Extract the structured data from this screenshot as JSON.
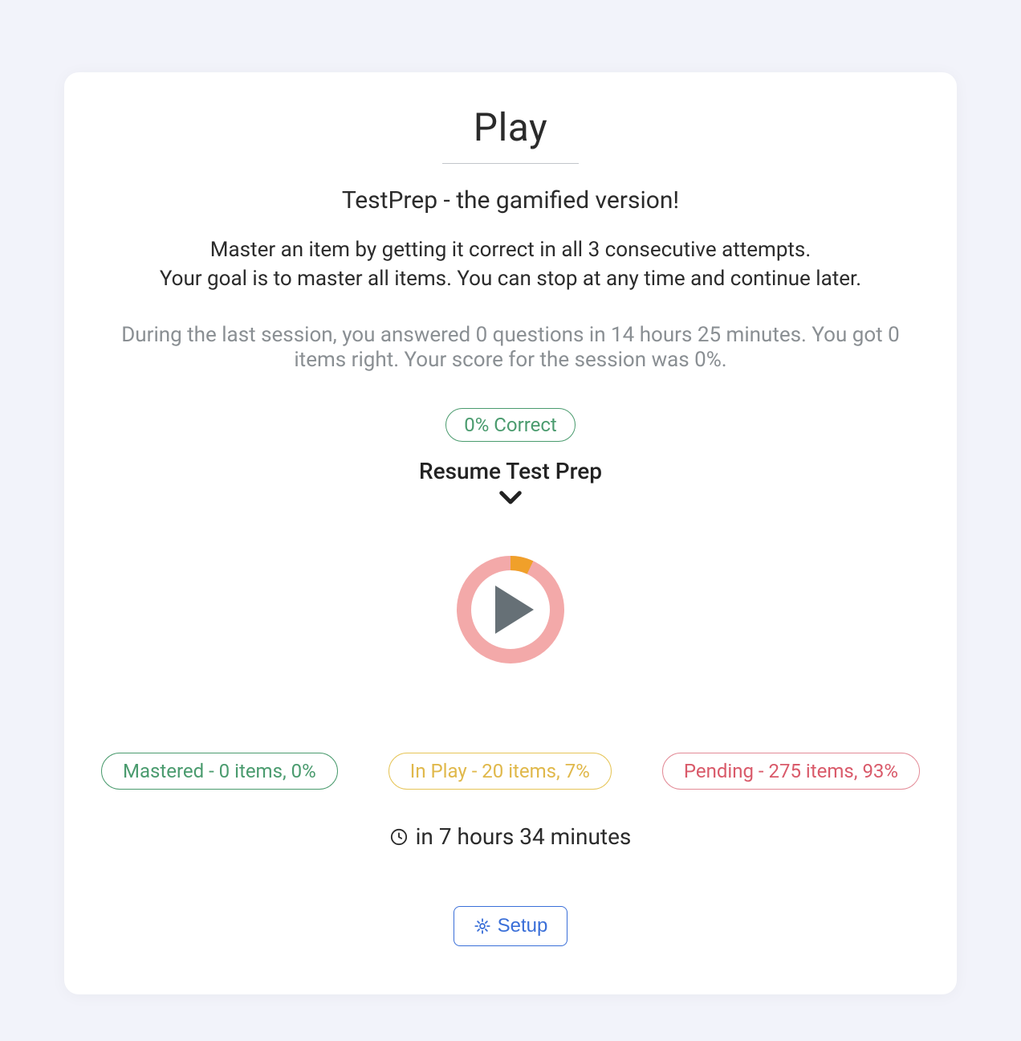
{
  "header": {
    "title": "Play",
    "subtitle": "TestPrep - the gamified version!",
    "intro_line1": "Master an item by getting it correct in all 3 consecutive attempts.",
    "intro_line2": "Your goal is to master all items. You can stop at any time and continue later."
  },
  "session_summary": "During the last session, you answered 0 questions in 14 hours 25 minutes. You got 0 items right. Your score for the session was 0%.",
  "correct_badge": "0% Correct",
  "resume_label": "Resume Test Prep",
  "progress_ring": {
    "pending_pct": 93,
    "inplay_pct": 7,
    "mastered_pct": 0
  },
  "badges": {
    "mastered": "Mastered - 0 items, 0%",
    "inplay": "In Play - 20 items, 7%",
    "pending": "Pending - 275 items, 93%"
  },
  "time_text": "in 7 hours 34 minutes",
  "setup_button": "Setup"
}
